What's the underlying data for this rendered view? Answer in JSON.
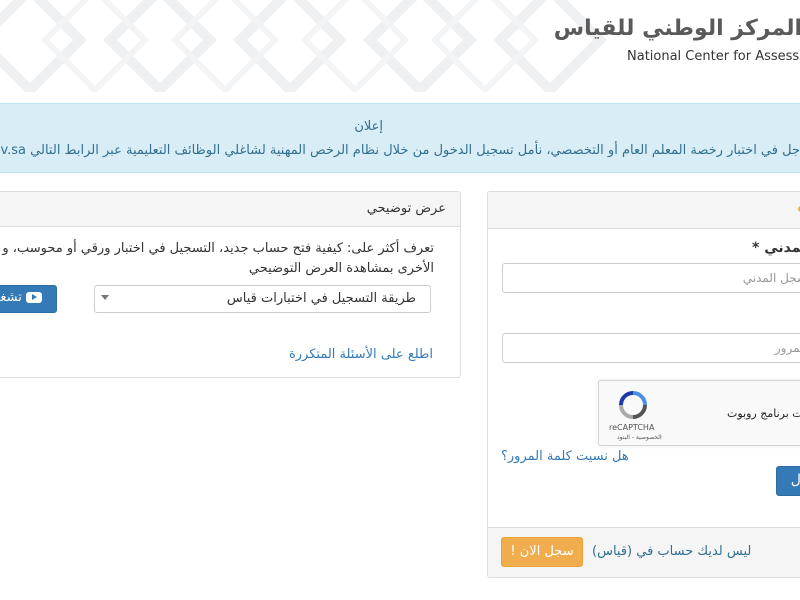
{
  "header": {
    "logo_ar": "المركز الوطني للقياس",
    "logo_en": "National Center for Assessment"
  },
  "announcement": {
    "title": "إعلان",
    "text": "جل في اختبار رخصة المعلم العام أو التخصصي، نأمل تسجيل الدخول من خلال نظام الرخص المهنية لشاغلي الوظائف التعليمية عبر الرابط التالي",
    "link_text": "ec.gov.sa"
  },
  "demo": {
    "title": "عرض توضيحي",
    "desc_line1": "تعرف أكثر على: كيفية فتح حساب جديد، التسجيل في اختبار ورقي أو محوسب، و",
    "desc_line2": "الأخرى بمشاهدة العرض التوضيحي",
    "select_value": "طريقة التسجيل في اختبارات قياس",
    "play_label": "تشغيل",
    "faq_link": "اطلع على الأسئلة المتكررة"
  },
  "login": {
    "id_label": "المدني *",
    "id_placeholder": "سجل المدني",
    "pass_label": "",
    "pass_placeholder": "المرور",
    "recaptcha_text": "ست برنامج روبوت",
    "recaptcha_brand": "reCAPTCHA",
    "recaptcha_links": "الخصوصية - البنود",
    "forgot_link": "هل نسيت كلمة المرور؟",
    "login_button": "دخول",
    "no_account_text": "ليس لديك حساب في (قياس)",
    "register_button": "سجل الان !"
  },
  "icons": {
    "play": "youtube-play-icon",
    "recaptcha": "recaptcha-logo-icon",
    "select_caret": "caret-down-icon"
  },
  "colors": {
    "primary": "#337ab7",
    "warning": "#f0ad4e",
    "info_bg": "#d9edf7",
    "info_text": "#31708f"
  }
}
